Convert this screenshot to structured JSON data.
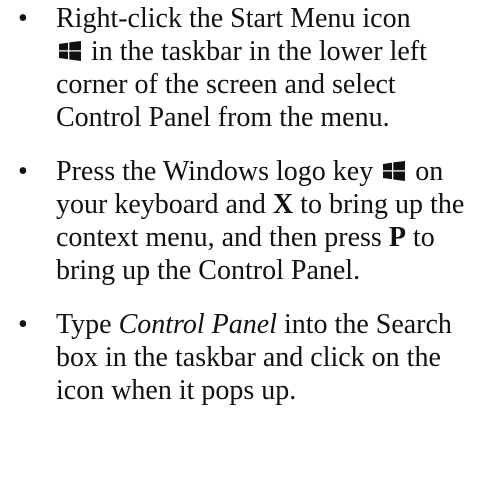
{
  "bullet_glyph": "•",
  "icon": "windows-logo-icon",
  "items": [
    {
      "part1": "Right-click the Start Menu icon",
      "part2": " in the taskbar in the lower left corner of the screen and select Control Panel from the menu."
    },
    {
      "part1": "Press the Windows logo key ",
      "part2": "on your keyboard and ",
      "key1": "X",
      "part3": " to bring up the context menu, and then press ",
      "key2": "P",
      "part4": " to bring up the Control Panel."
    },
    {
      "part1": "Type ",
      "emphasis": "Control Panel",
      "part2": " into the Search box in the taskbar and click on the icon when it pops up."
    }
  ]
}
